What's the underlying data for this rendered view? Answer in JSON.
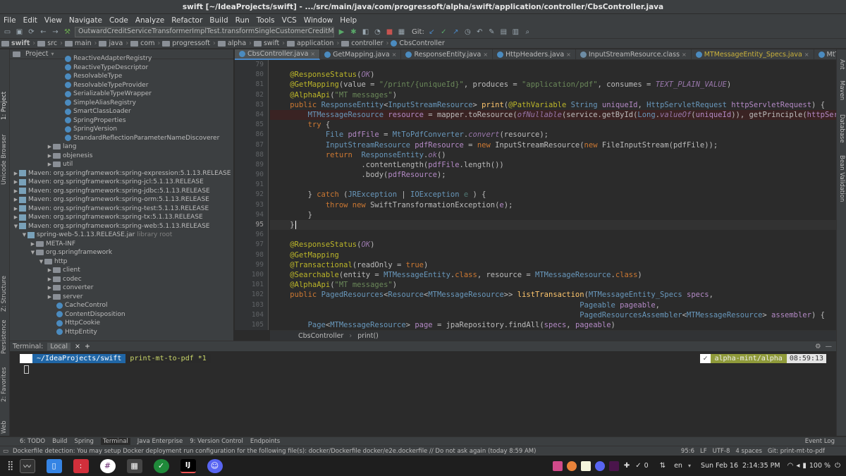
{
  "window": {
    "title": "swift [~/IdeaProjects/swift] - .../src/main/java/com/progressoft/alpha/swift/application/controller/CbsController.java"
  },
  "menu": [
    "File",
    "Edit",
    "View",
    "Navigate",
    "Code",
    "Analyze",
    "Refactor",
    "Build",
    "Run",
    "Tools",
    "VCS",
    "Window",
    "Help"
  ],
  "toolbar": {
    "run_config": "OutwardCreditServiceTransformerImplTest.transformSingleCustomerCreditMemberId",
    "git_label": "Git:"
  },
  "nav": [
    "swift",
    "src",
    "main",
    "java",
    "com",
    "progressoft",
    "alpha",
    "swift",
    "application",
    "controller",
    "CbsController"
  ],
  "side_left": [
    "1: Project",
    "Unicode Browser",
    "Z: Structure",
    "Persistence",
    "2: Favorites",
    "Web"
  ],
  "side_right": [
    "Ant",
    "Maven",
    "Database",
    "Bean Validation"
  ],
  "project": {
    "title": "Project",
    "items": [
      {
        "label": "ReactiveAdapterRegistry",
        "kind": "class",
        "indent": 5
      },
      {
        "label": "ReactiveTypeDescriptor",
        "kind": "class",
        "indent": 5
      },
      {
        "label": "ResolvableType",
        "kind": "class",
        "indent": 5
      },
      {
        "label": "ResolvableTypeProvider",
        "kind": "class",
        "indent": 5
      },
      {
        "label": "SerializableTypeWrapper",
        "kind": "class",
        "indent": 5
      },
      {
        "label": "SimpleAliasRegistry",
        "kind": "class",
        "indent": 5
      },
      {
        "label": "SmartClassLoader",
        "kind": "class",
        "indent": 5
      },
      {
        "label": "SpringProperties",
        "kind": "class",
        "indent": 5
      },
      {
        "label": "SpringVersion",
        "kind": "class",
        "indent": 5
      },
      {
        "label": "StandardReflectionParameterNameDiscoverer",
        "kind": "class",
        "indent": 5
      },
      {
        "label": "lang",
        "kind": "folder",
        "indent": 4,
        "arrow": "▶"
      },
      {
        "label": "objenesis",
        "kind": "folder",
        "indent": 4,
        "arrow": "▶"
      },
      {
        "label": "util",
        "kind": "folder",
        "indent": 4,
        "arrow": "▶"
      },
      {
        "label": "Maven: org.springframework:spring-expression:5.1.13.RELEASE",
        "kind": "lib",
        "indent": 0,
        "arrow": "▶"
      },
      {
        "label": "Maven: org.springframework:spring-jcl:5.1.13.RELEASE",
        "kind": "lib",
        "indent": 0,
        "arrow": "▶"
      },
      {
        "label": "Maven: org.springframework:spring-jdbc:5.1.13.RELEASE",
        "kind": "lib",
        "indent": 0,
        "arrow": "▶"
      },
      {
        "label": "Maven: org.springframework:spring-orm:5.1.13.RELEASE",
        "kind": "lib",
        "indent": 0,
        "arrow": "▶"
      },
      {
        "label": "Maven: org.springframework:spring-test:5.1.13.RELEASE",
        "kind": "lib",
        "indent": 0,
        "arrow": "▶"
      },
      {
        "label": "Maven: org.springframework:spring-tx:5.1.13.RELEASE",
        "kind": "lib",
        "indent": 0,
        "arrow": "▶"
      },
      {
        "label": "Maven: org.springframework:spring-web:5.1.13.RELEASE",
        "kind": "lib",
        "indent": 0,
        "arrow": "▼"
      },
      {
        "label": "spring-web-5.1.13.RELEASE.jar",
        "kind": "jar",
        "indent": 1,
        "arrow": "▼",
        "note": "library root"
      },
      {
        "label": "META-INF",
        "kind": "folder",
        "indent": 2,
        "arrow": "▶"
      },
      {
        "label": "org.springframework",
        "kind": "folder",
        "indent": 2,
        "arrow": "▼"
      },
      {
        "label": "http",
        "kind": "folder",
        "indent": 3,
        "arrow": "▼"
      },
      {
        "label": "client",
        "kind": "folder",
        "indent": 4,
        "arrow": "▶"
      },
      {
        "label": "codec",
        "kind": "folder",
        "indent": 4,
        "arrow": "▶"
      },
      {
        "label": "converter",
        "kind": "folder",
        "indent": 4,
        "arrow": "▶"
      },
      {
        "label": "server",
        "kind": "folder",
        "indent": 4,
        "arrow": "▶"
      },
      {
        "label": "CacheControl",
        "kind": "class",
        "indent": 4
      },
      {
        "label": "ContentDisposition",
        "kind": "class",
        "indent": 4
      },
      {
        "label": "HttpCookie",
        "kind": "class",
        "indent": 4
      },
      {
        "label": "HttpEntity",
        "kind": "class",
        "indent": 4
      }
    ]
  },
  "tabs": [
    {
      "label": "CbsController.java",
      "active": true
    },
    {
      "label": "GetMapping.java"
    },
    {
      "label": "ResponseEntity.java"
    },
    {
      "label": "HttpHeaders.java"
    },
    {
      "label": "InputStreamResource.class"
    },
    {
      "label": "MTMessageEntity_Specs.java",
      "color": "#c9b13b"
    },
    {
      "label": "MtToPdfConverter.java"
    }
  ],
  "editor": {
    "line_numbers": [
      "79",
      "80",
      "81",
      "82",
      "83",
      "84",
      "85",
      "86",
      "87",
      "88",
      "89",
      "90",
      "91",
      "92",
      "93",
      "94",
      "95",
      "96",
      "97",
      "98",
      "99",
      "100",
      "101",
      "102",
      "103",
      "104",
      "105"
    ],
    "breadcrumb": [
      "CbsController",
      "print()"
    ]
  },
  "terminal": {
    "title": "Terminal:",
    "tab": "Local",
    "path": "~/IdeaProjects/swift",
    "branch": "print-mt-to-pdf *1",
    "host": "alpha-mint/alpha",
    "time": "08:59:13"
  },
  "bottom_tabs": [
    "6: TODO",
    "Build",
    "Spring",
    "Terminal",
    "Java Enterprise",
    "9: Version Control",
    "Endpoints"
  ],
  "event_log": "Event Log",
  "status": {
    "message": "Dockerfile detection: You may setup Docker deployment run configuration for the following file(s): docker/Dockerfile docker/e2e.dockerfile // Do not ask again (today 8:59 AM)",
    "position": "95:6",
    "line_sep": "LF",
    "encoding": "UTF-8",
    "indent": "4 spaces",
    "git": "Git: print-mt-to-pdf"
  },
  "taskbar": {
    "notifications": "0",
    "lang": "en",
    "clock": "Sun Feb 16  2:14:35 PM",
    "battery": "100 %"
  }
}
